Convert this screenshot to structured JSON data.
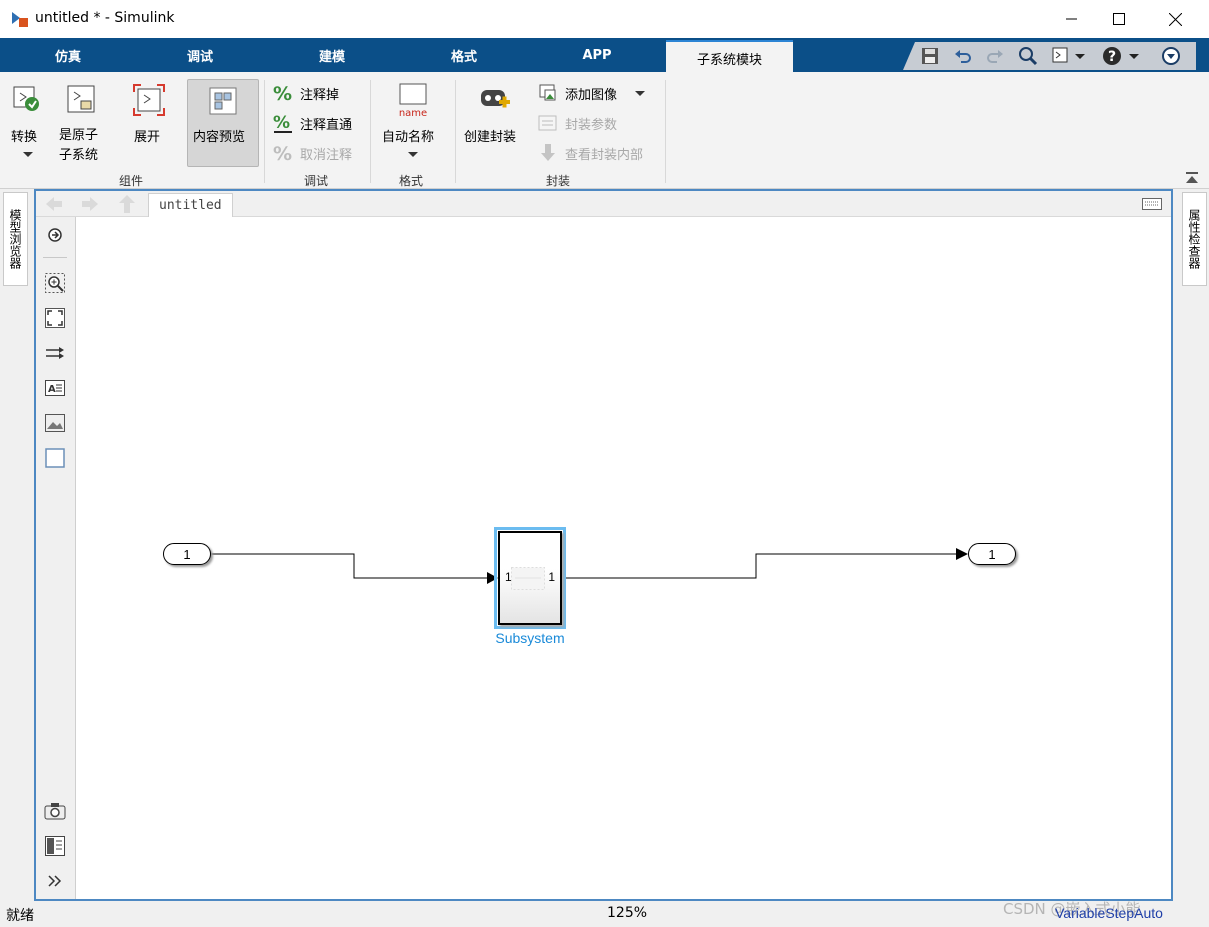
{
  "window": {
    "title": "untitled * - Simulink"
  },
  "tabs": [
    "仿真",
    "调试",
    "建模",
    "格式",
    "APP",
    "子系统模块"
  ],
  "ribbon": {
    "groups": [
      {
        "label": "组件",
        "items": [
          "转换",
          "是原子\n子系统",
          "展开",
          "内容预览"
        ]
      },
      {
        "label": "调试",
        "items": [
          "注释掉",
          "注释直通",
          "取消注释"
        ]
      },
      {
        "label": "格式",
        "items": [
          "自动名称"
        ],
        "icon_text": "name"
      },
      {
        "label": "封装",
        "items": [
          "创建封装",
          "添加图像",
          "封装参数",
          "查看封装内部"
        ]
      }
    ]
  },
  "panels": {
    "left": "模型浏览器",
    "right": "属性检查器"
  },
  "breadcrumb": "untitled",
  "diagram": {
    "inport_label": "1",
    "outport_label": "1",
    "subsystem": {
      "name": "Subsystem",
      "in_port": "1",
      "out_port": "1"
    }
  },
  "status": {
    "left": "就绪",
    "zoom": "125%",
    "solver": "VariableStepAuto",
    "watermark": "CSDN @嵌入式小能"
  },
  "colors": {
    "tabbar": "#0b4f88",
    "selection": "#6bbcf0",
    "block_label": "#1a8ad8"
  }
}
